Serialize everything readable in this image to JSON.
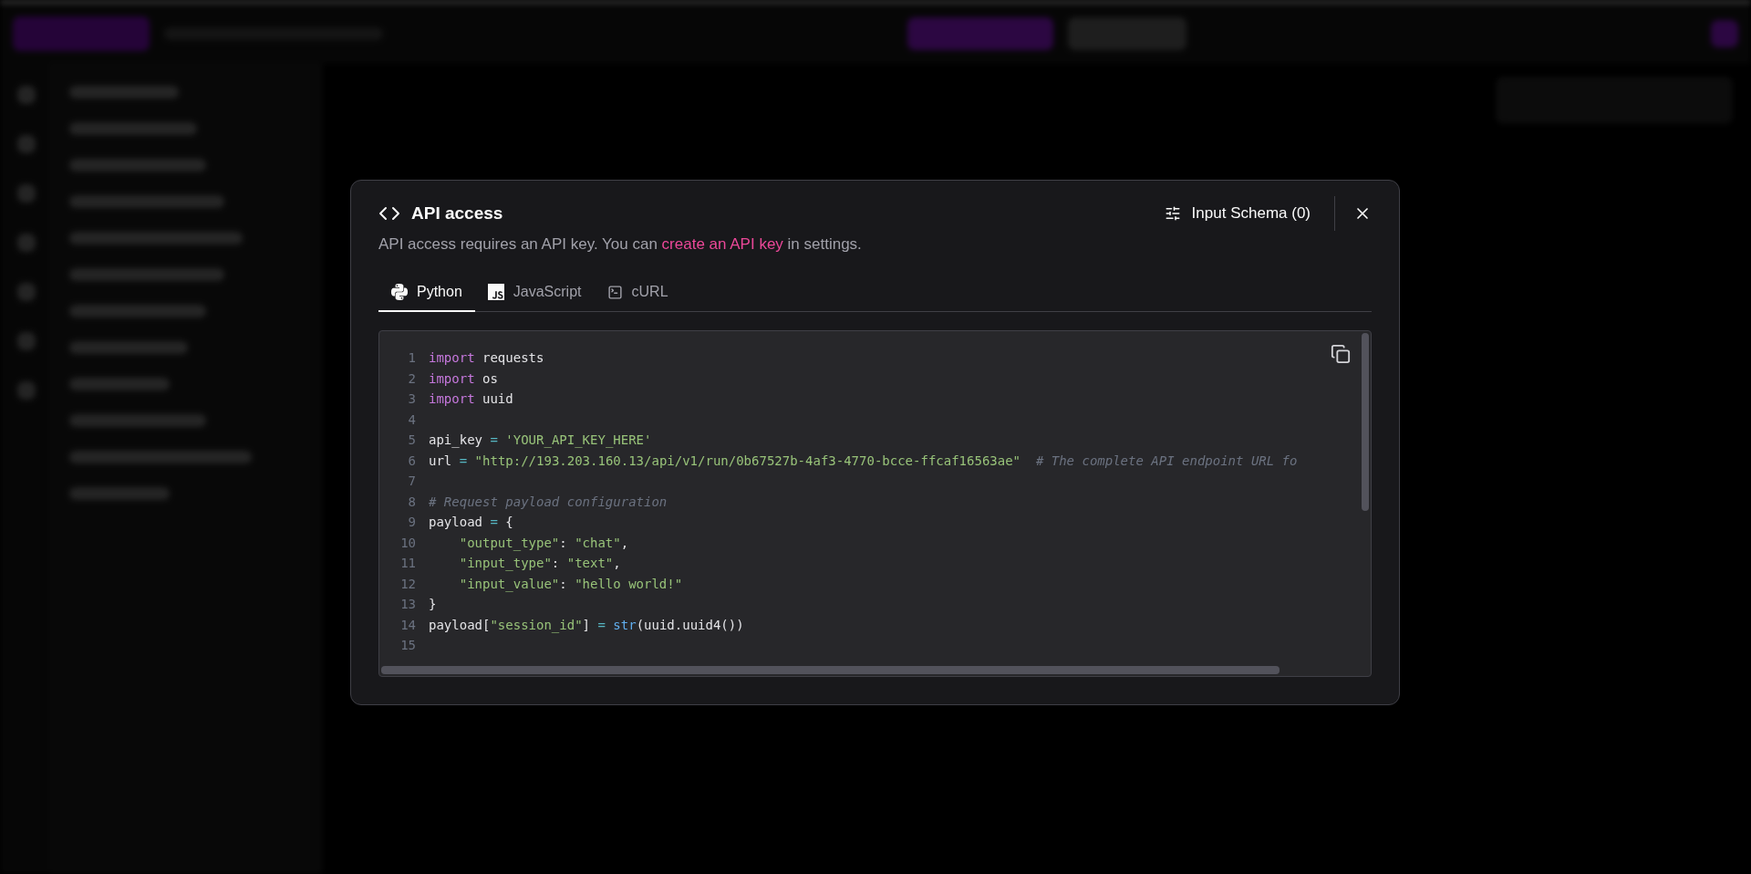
{
  "dialog": {
    "title": "API access",
    "schema_button": "Input Schema (0)",
    "description": {
      "before": "API access requires an API key. You can ",
      "link": "create an API key",
      "after": " in settings."
    },
    "tabs": [
      {
        "label": "Python",
        "selected": true
      },
      {
        "label": "JavaScript",
        "selected": false
      },
      {
        "label": "cURL",
        "selected": false
      }
    ],
    "code": {
      "lines": [
        {
          "number": "1",
          "tokens": [
            {
              "kind": "keyword",
              "text": "import"
            },
            {
              "kind": "plain",
              "text": " requests"
            }
          ]
        },
        {
          "number": "2",
          "tokens": [
            {
              "kind": "keyword",
              "text": "import"
            },
            {
              "kind": "plain",
              "text": " os"
            }
          ]
        },
        {
          "number": "3",
          "tokens": [
            {
              "kind": "keyword",
              "text": "import"
            },
            {
              "kind": "plain",
              "text": " uuid"
            }
          ]
        },
        {
          "number": "4"
        },
        {
          "number": "5",
          "tokens": [
            {
              "kind": "plain",
              "text": "api_key"
            },
            {
              "kind": "operator",
              "text": " = "
            },
            {
              "kind": "string",
              "text": "'YOUR_API_KEY_HERE'"
            }
          ]
        },
        {
          "number": "6",
          "tokens": [
            {
              "kind": "plain",
              "text": "url"
            },
            {
              "kind": "operator",
              "text": " = "
            },
            {
              "kind": "string",
              "text": "\"http://193.203.160.13/api/v1/run/0b67527b-4af3-4770-bcce-ffcaf16563ae\""
            },
            {
              "kind": "comment",
              "text": "  # The complete API endpoint URL fo"
            }
          ]
        },
        {
          "number": "7"
        },
        {
          "number": "8",
          "tokens": [
            {
              "kind": "comment",
              "text": "# Request payload configuration"
            }
          ]
        },
        {
          "number": "9",
          "tokens": [
            {
              "kind": "plain",
              "text": "payload"
            },
            {
              "kind": "operator",
              "text": " = "
            },
            {
              "kind": "plain",
              "text": "{"
            }
          ]
        },
        {
          "number": "10",
          "tokens": [
            {
              "kind": "string",
              "text": "    \"output_type\""
            },
            {
              "kind": "plain",
              "text": ": "
            },
            {
              "kind": "string",
              "text": "\"chat\""
            },
            {
              "kind": "plain",
              "text": ","
            }
          ]
        },
        {
          "number": "11",
          "tokens": [
            {
              "kind": "string",
              "text": "    \"input_type\""
            },
            {
              "kind": "plain",
              "text": ": "
            },
            {
              "kind": "string",
              "text": "\"text\""
            },
            {
              "kind": "plain",
              "text": ","
            }
          ]
        },
        {
          "number": "12",
          "tokens": [
            {
              "kind": "string",
              "text": "    \"input_value\""
            },
            {
              "kind": "plain",
              "text": ": "
            },
            {
              "kind": "string",
              "text": "\"hello world!\""
            }
          ]
        },
        {
          "number": "13",
          "tokens": [
            {
              "kind": "plain",
              "text": "}"
            }
          ]
        },
        {
          "number": "14",
          "tokens": [
            {
              "kind": "plain",
              "text": "payload["
            },
            {
              "kind": "string",
              "text": "\"session_id\""
            },
            {
              "kind": "plain",
              "text": "]"
            },
            {
              "kind": "operator",
              "text": " = "
            },
            {
              "kind": "builtin",
              "text": "str"
            },
            {
              "kind": "plain",
              "text": "(uuid.uuid4())"
            }
          ]
        },
        {
          "number": "15"
        }
      ]
    }
  }
}
